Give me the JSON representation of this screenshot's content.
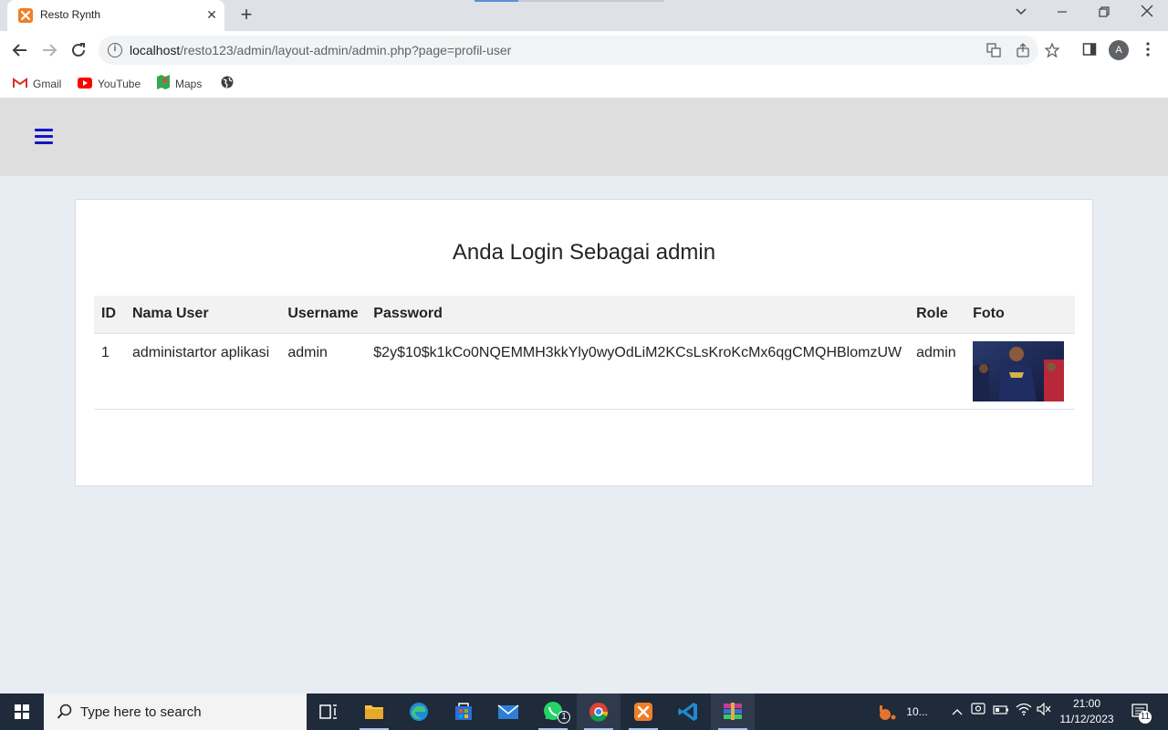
{
  "browser": {
    "tab_title": "Resto Rynth",
    "tab_close": "✕",
    "new_tab": "+",
    "url_host": "localhost",
    "url_path": "/resto123/admin/layout-admin/admin.php?page=profil-user",
    "profile_initial": "A"
  },
  "bookmarks": [
    {
      "label": "Gmail",
      "icon": "gmail-icon"
    },
    {
      "label": "YouTube",
      "icon": "youtube-icon"
    },
    {
      "label": "Maps",
      "icon": "maps-icon"
    }
  ],
  "page": {
    "title": "Anda Login Sebagai admin",
    "table": {
      "headers": [
        "ID",
        "Nama User",
        "Username",
        "Password",
        "Role",
        "Foto"
      ],
      "rows": [
        {
          "id": "1",
          "nama_user": "administartor aplikasi",
          "username": "admin",
          "password": "$2y$10$k1kCo0NQEMMH3kkYly0wyOdLiM2KCsLsKroKcMx6qgCMQHBlomzUW",
          "role": "admin",
          "foto": "user-photo"
        }
      ]
    }
  },
  "taskbar": {
    "search_placeholder": "Type here to search",
    "whatsapp_badge": "1",
    "weather_text": "10...",
    "time": "21:00",
    "date": "11/12/2023",
    "notification_count": "11"
  },
  "colors": {
    "accent_menu": "#1414c8",
    "page_bg": "#e8ecf3",
    "header_bg": "#dedede"
  }
}
